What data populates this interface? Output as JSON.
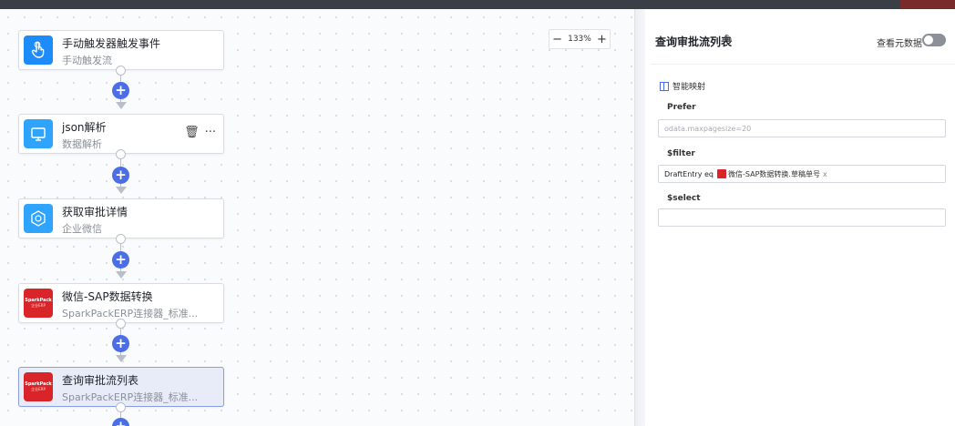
{
  "zoom": {
    "minus": "−",
    "value": "133%",
    "plus": "+"
  },
  "nodes": [
    {
      "title": "手动触发器触发事件",
      "subtitle": "手动触发流",
      "icon": "hand-pointer-icon"
    },
    {
      "title": "json解析",
      "subtitle": "数据解析",
      "icon": "monitor-icon",
      "actions": {
        "delete": "🗑",
        "more": "···"
      }
    },
    {
      "title": "获取审批详情",
      "subtitle": "企业微信",
      "icon": "hexagon-icon"
    },
    {
      "title": "微信-SAP数据转换",
      "subtitle": "SparkPackERP连接器_标准...",
      "icon": "sparkpack-logo",
      "logo_text": "SparkPack",
      "logo_sub": "企业ERP"
    },
    {
      "title": "查询审批流列表",
      "subtitle": "SparkPackERP连接器_标准...",
      "icon": "sparkpack-logo",
      "logo_text": "SparkPack",
      "logo_sub": "企业ERP"
    }
  ],
  "add_label": "+",
  "panel": {
    "title": "查询审批流列表",
    "edit_icon": "✎",
    "metadata_label": "查看元数据",
    "smart_mapping": "智能映射",
    "fields": {
      "prefer": {
        "label": "Prefer",
        "placeholder": "odata.maxpagesize=20"
      },
      "filter": {
        "label": "$filter",
        "value": "DraftEntry eq",
        "tag": "微信-SAP数据转换.草稿单号",
        "tag_close": "x"
      },
      "select": {
        "label": "$select",
        "value": ""
      }
    }
  },
  "colors": {
    "accent": "#4b6ee6",
    "sparkpack_red": "#d9252a",
    "icon_blue": "#1d8cf8"
  }
}
